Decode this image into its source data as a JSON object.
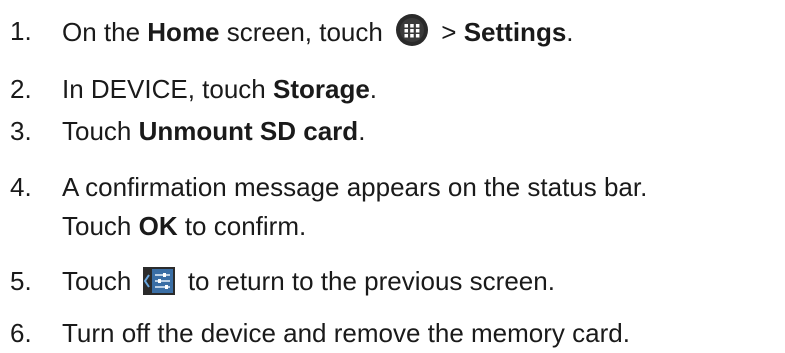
{
  "steps": [
    {
      "number": "1.",
      "parts": {
        "a": "On the ",
        "b": "Home",
        "c": " screen, touch ",
        "icon": "apps-grid-icon",
        "d": " > ",
        "e": "Settings",
        "f": "."
      }
    },
    {
      "number": "2.",
      "parts": {
        "a": "In DEVICE, touch ",
        "b": "Storage",
        "c": "."
      }
    },
    {
      "number": "3.",
      "parts": {
        "a": "Touch ",
        "b": "Unmount SD card",
        "c": "."
      }
    },
    {
      "number": "4.",
      "parts": {
        "line1": "A confirmation message appears on the status bar.",
        "a": "Touch ",
        "b": "OK",
        "c": " to confirm."
      }
    },
    {
      "number": "5.",
      "parts": {
        "a": "Touch ",
        "icon": "settings-back-icon",
        "b": " to return to the previous screen."
      }
    },
    {
      "number": "6.",
      "parts": {
        "a": "Turn off the device and remove the memory card."
      }
    }
  ],
  "colors": {
    "text": "#1a1a1a",
    "icon_dark": "#2a2a2a",
    "icon_blue": "#3a6ea5"
  }
}
